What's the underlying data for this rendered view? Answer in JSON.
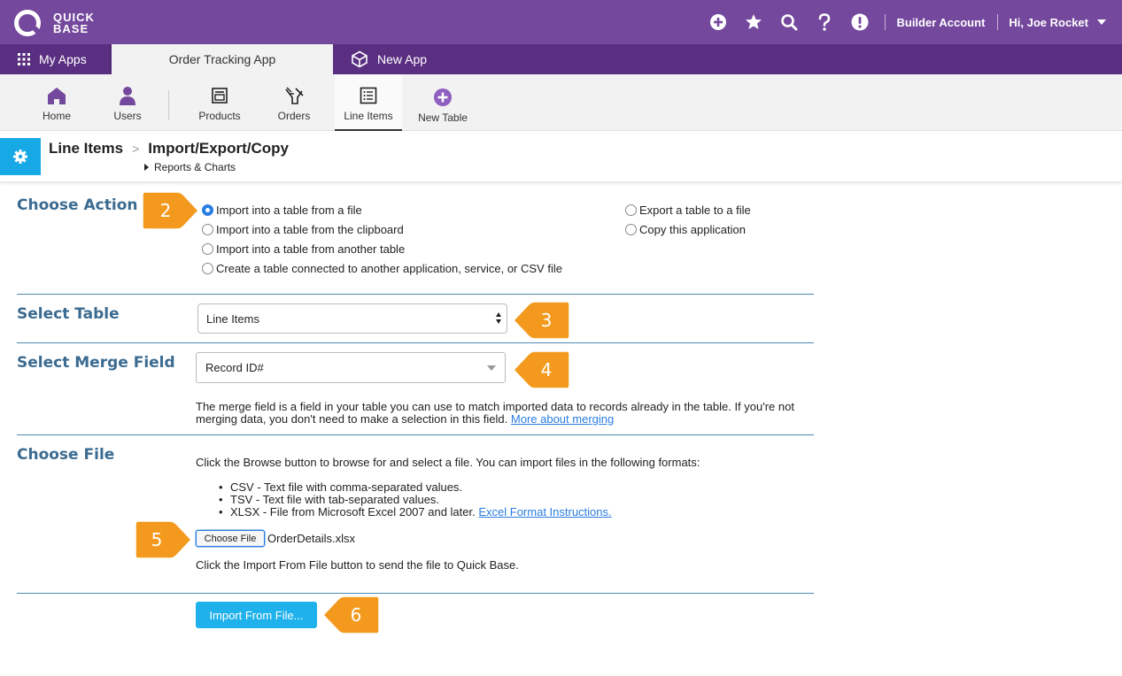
{
  "brand": {
    "line1": "QUICK",
    "line2": "BASE"
  },
  "topbar": {
    "icons": [
      "add-icon",
      "star-icon",
      "search-icon",
      "help-icon",
      "alert-icon"
    ],
    "account": "Builder Account",
    "greeting": "Hi, Joe Rocket"
  },
  "app_tabs": {
    "my_apps": "My Apps",
    "active": "Order Tracking App",
    "new_app": "New App"
  },
  "table_nav": [
    {
      "label": "Home",
      "icon": "home-icon"
    },
    {
      "label": "Users",
      "icon": "user-icon"
    },
    {
      "label": "Products",
      "icon": "products-icon"
    },
    {
      "label": "Orders",
      "icon": "orders-icon"
    },
    {
      "label": "Line Items",
      "icon": "list-icon"
    },
    {
      "label": "New Table",
      "icon": "plus-circle-icon"
    }
  ],
  "breadcrumb": {
    "parent": "Line Items",
    "current": "Import/Export/Copy",
    "sub": "Reports & Charts"
  },
  "choose_action": {
    "title": "Choose Action",
    "options_left": [
      "Import into a table from a file",
      "Import into a table from the clipboard",
      "Import into a table from another table",
      "Create a table connected to another application, service, or CSV file"
    ],
    "options_right": [
      "Export a table to a file",
      "Copy this application"
    ],
    "selected": "Import into a table from a file"
  },
  "select_table": {
    "title": "Select Table",
    "value": "Line Items"
  },
  "merge_field": {
    "title": "Select Merge Field",
    "value": "Record ID#",
    "help_text": "The merge field is a field in your table you can use to match imported data to records already in the table. If you're not merging data, you don't need to make a selection in this field.",
    "help_link": "More about merging"
  },
  "choose_file": {
    "title": "Choose File",
    "intro": "Click the Browse button to browse for and select a file. You can import files in the following formats:",
    "formats": [
      "CSV - Text file with comma-separated values.",
      "TSV - Text file with tab-separated values.",
      "XLSX - File from Microsoft Excel 2007 and later."
    ],
    "excel_link": "Excel Format Instructions.",
    "button": "Choose File",
    "filename": "OrderDetails.xlsx",
    "outro": "Click the Import From File button to send the file to Quick Base."
  },
  "import_button": "Import From File...",
  "callouts": [
    "2",
    "3",
    "4",
    "5",
    "6"
  ],
  "colors": {
    "header": "#74489d",
    "tabbar": "#5a2f81",
    "accent": "#17a9e6",
    "section_title": "#3b6b91",
    "callout": "#f39a1e"
  }
}
